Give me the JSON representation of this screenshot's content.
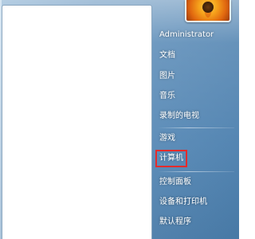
{
  "start_menu": {
    "user": {
      "name": "Administrator",
      "avatar": "flower-avatar"
    },
    "items": [
      {
        "label": "文档"
      },
      {
        "label": "图片"
      },
      {
        "label": "音乐"
      },
      {
        "label": "录制的电视"
      },
      {
        "label": "游戏"
      },
      {
        "label": "计算机"
      },
      {
        "label": "控制面板"
      },
      {
        "label": "设备和打印机"
      },
      {
        "label": "默认程序"
      }
    ],
    "highlighted_item": "计算机",
    "colors": {
      "highlight_border": "#e52b2b",
      "pane_background": "#ffffff",
      "frame": "#5e8fbb"
    }
  }
}
